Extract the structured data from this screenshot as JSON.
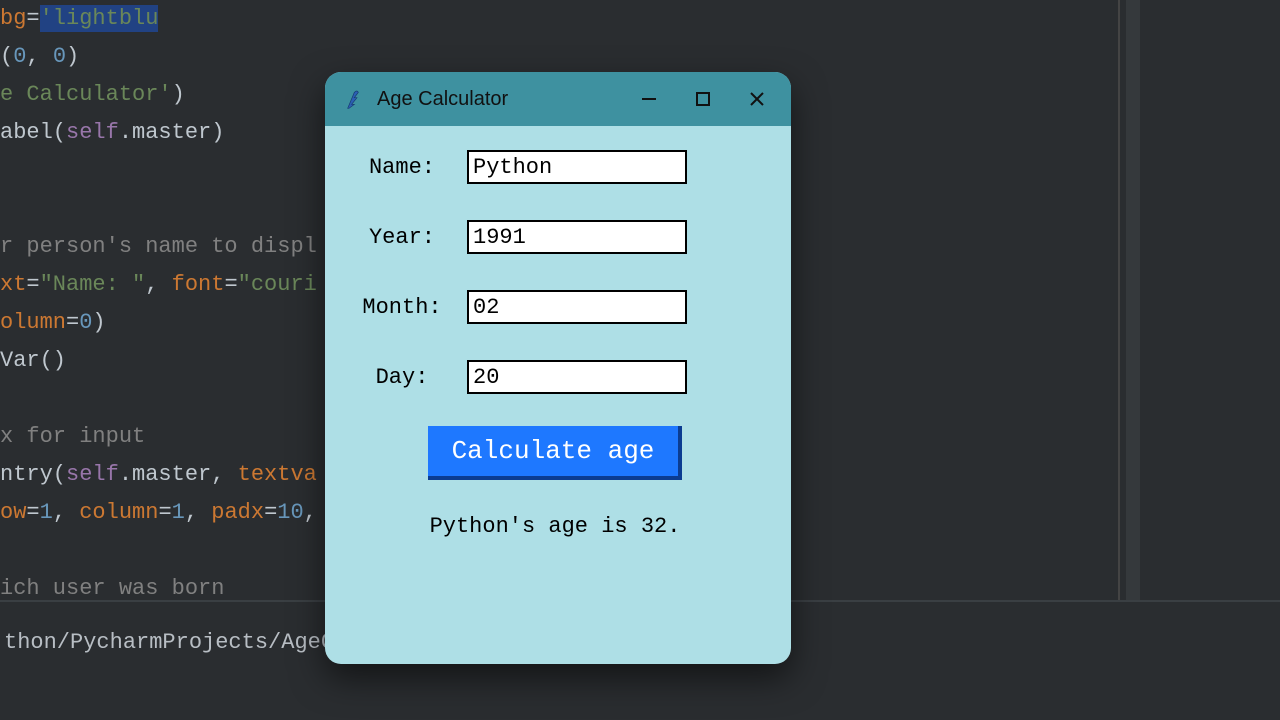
{
  "ide": {
    "code_lines": [
      {
        "segs": [
          {
            "t": "bg",
            "c": "tok-kwarg"
          },
          {
            "t": "=",
            "c": "tok-plain"
          },
          {
            "t": "'lightblu",
            "c": "tok-str sel-bg"
          }
        ]
      },
      {
        "segs": [
          {
            "t": "(",
            "c": "tok-plain"
          },
          {
            "t": "0",
            "c": "tok-num"
          },
          {
            "t": ", ",
            "c": "tok-plain"
          },
          {
            "t": "0",
            "c": "tok-num"
          },
          {
            "t": ")",
            "c": "tok-plain"
          }
        ]
      },
      {
        "segs": [
          {
            "t": "e Calculator'",
            "c": "tok-str"
          },
          {
            "t": ")",
            "c": "tok-plain"
          }
        ]
      },
      {
        "segs": [
          {
            "t": "abel(",
            "c": "tok-plain"
          },
          {
            "t": "self",
            "c": "tok-self"
          },
          {
            "t": ".master)",
            "c": "tok-plain"
          }
        ]
      },
      {
        "segs": []
      },
      {
        "segs": []
      },
      {
        "segs": [
          {
            "t": "r person's name to displ",
            "c": "tok-comment"
          }
        ]
      },
      {
        "segs": [
          {
            "t": "xt",
            "c": "tok-kwarg"
          },
          {
            "t": "=",
            "c": "tok-plain"
          },
          {
            "t": "\"Name: \"",
            "c": "tok-str"
          },
          {
            "t": ", ",
            "c": "tok-plain"
          },
          {
            "t": "font",
            "c": "tok-kwarg"
          },
          {
            "t": "=",
            "c": "tok-plain"
          },
          {
            "t": "\"couri",
            "c": "tok-str"
          }
        ]
      },
      {
        "segs": [
          {
            "t": "olumn",
            "c": "tok-kwarg"
          },
          {
            "t": "=",
            "c": "tok-plain"
          },
          {
            "t": "0",
            "c": "tok-num"
          },
          {
            "t": ")",
            "c": "tok-plain"
          }
        ]
      },
      {
        "segs": [
          {
            "t": "Var()",
            "c": "tok-plain"
          }
        ]
      },
      {
        "segs": []
      },
      {
        "segs": [
          {
            "t": "x for input",
            "c": "tok-comment"
          }
        ]
      },
      {
        "segs": [
          {
            "t": "ntry(",
            "c": "tok-plain"
          },
          {
            "t": "self",
            "c": "tok-self"
          },
          {
            "t": ".master, ",
            "c": "tok-plain"
          },
          {
            "t": "textva",
            "c": "tok-kwarg"
          }
        ]
      },
      {
        "segs": [
          {
            "t": "ow",
            "c": "tok-kwarg"
          },
          {
            "t": "=",
            "c": "tok-plain"
          },
          {
            "t": "1",
            "c": "tok-num"
          },
          {
            "t": ", ",
            "c": "tok-plain"
          },
          {
            "t": "column",
            "c": "tok-kwarg"
          },
          {
            "t": "=",
            "c": "tok-plain"
          },
          {
            "t": "1",
            "c": "tok-num"
          },
          {
            "t": ", ",
            "c": "tok-plain"
          },
          {
            "t": "padx",
            "c": "tok-kwarg"
          },
          {
            "t": "=",
            "c": "tok-plain"
          },
          {
            "t": "10",
            "c": "tok-num"
          },
          {
            "t": ",",
            "c": "tok-plain"
          }
        ]
      },
      {
        "segs": []
      },
      {
        "segs": [
          {
            "t": "ich user was born",
            "c": "tok-comment"
          }
        ]
      }
    ],
    "status_path": "thon/PycharmProjects/AgeCalculator/main.py"
  },
  "window": {
    "title": "Age Calculator",
    "titlebar_bg": "#3e91a0",
    "body_bg": "#aedfe6",
    "form": {
      "name_label": "Name:",
      "name_value": "Python",
      "year_label": "Year:",
      "year_value": "1991",
      "month_label": "Month:",
      "month_value": "02",
      "day_label": "Day:",
      "day_value": "20"
    },
    "button_label": "Calculate age",
    "result_text": "Python's age is 32."
  }
}
